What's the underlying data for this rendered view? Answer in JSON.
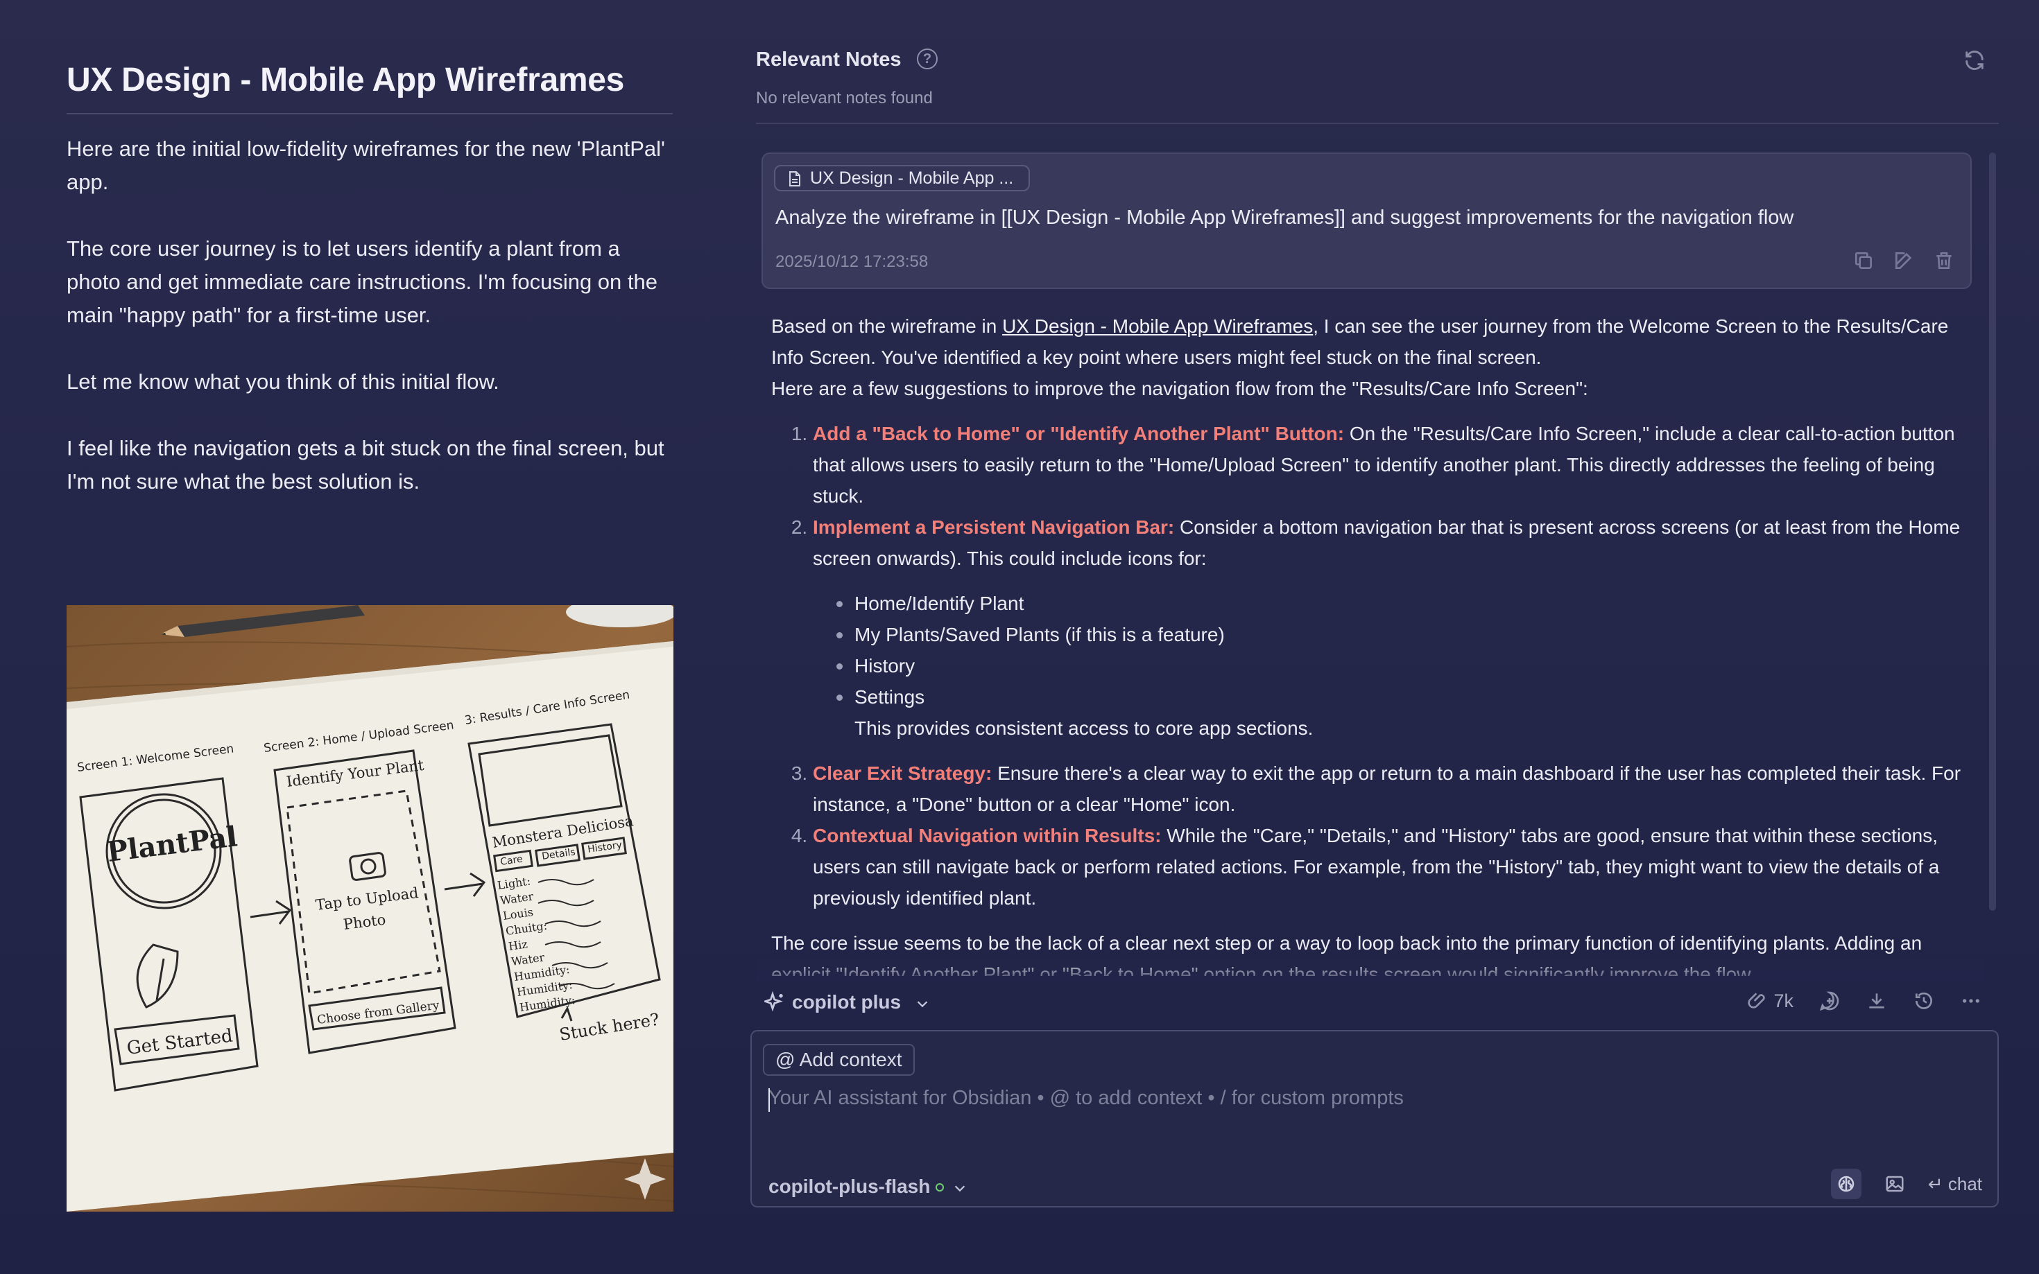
{
  "note": {
    "title": "UX Design - Mobile App Wireframes",
    "paragraphs": [
      "Here are the initial low-fidelity wireframes for the new 'PlantPal' app.",
      "The core user journey is to let users identify a plant from a photo and get immediate care instructions. I'm focusing on the main \"happy path\" for a first-time user.",
      "Let me know what you think of this initial flow.",
      "I feel like the navigation gets a bit stuck on the final screen, but I'm not sure what the best solution is."
    ],
    "image": {
      "screen1_label": "Screen 1: Welcome Screen",
      "screen2_label": "Screen 2: Home / Upload Screen",
      "screen3_label": "3: Results / Care Info Screen",
      "logo": "PlantPal",
      "get_started": "Get Started",
      "identify": "Identify Your Plant",
      "tap_upload_1": "Tap to Upload",
      "tap_upload_2": "Photo",
      "gallery": "Choose from Gallery",
      "plant_name": "Monstera Deliciosa",
      "tabs": [
        "Care",
        "Details",
        "History"
      ],
      "care_rows": [
        "Light:",
        "Water",
        "Louis",
        "Chuitg:",
        "Hiz",
        "Water",
        "Humidity:",
        "Humidity:",
        "Humidity:"
      ],
      "stuck": "Stuck here?"
    }
  },
  "relevant": {
    "title": "Relevant Notes",
    "empty": "No relevant notes found"
  },
  "user_message": {
    "context_chip": "UX Design - Mobile App ...",
    "text": "Analyze the wireframe in [[UX Design - Mobile App Wireframes]] and suggest improvements for the navigation flow",
    "timestamp": "2025/10/12 17:23:58"
  },
  "reply": {
    "intro_before_link": "Based on the wireframe in ",
    "intro_link": "UX Design - Mobile App Wireframes",
    "intro_after_link": ", I can see the user journey from the Welcome Screen to the Results/Care Info Screen. You've identified a key point where users might feel stuck on the final screen.",
    "intro_line2": "Here are a few suggestions to improve the navigation flow from the \"Results/Care Info Screen\":",
    "items": [
      {
        "title": "Add a \"Back to Home\" or \"Identify Another Plant\" Button:",
        "body": " On the \"Results/Care Info Screen,\" include a clear call-to-action button that allows users to easily return to the \"Home/Upload Screen\" to identify another plant. This directly addresses the feeling of being stuck."
      },
      {
        "title": "Implement a Persistent Navigation Bar:",
        "body": " Consider a bottom navigation bar that is present across screens (or at least from the Home screen onwards). This could include icons for:"
      },
      {
        "title": "Clear Exit Strategy:",
        "body": " Ensure there's a clear way to exit the app or return to a main dashboard if the user has completed their task. For instance, a \"Done\" button or a clear \"Home\" icon."
      },
      {
        "title": "Contextual Navigation within Results:",
        "body": " While the \"Care,\" \"Details,\" and \"History\" tabs are good, ensure that within these sections, users can still navigate back or perform related actions. For example, from the \"History\" tab, they might want to view the details of a previously identified plant."
      }
    ],
    "nav_icons": [
      "Home/Identify Plant",
      "My Plants/Saved Plants (if this is a feature)",
      "History",
      "Settings"
    ],
    "nav_note": "This provides consistent access to core app sections.",
    "conclusion": "The core issue seems to be the lack of a clear next step or a way to loop back into the primary function of identifying plants. Adding an explicit \"Identify Another Plant\" or \"Back to Home\" option on the results screen would significantly improve the flow."
  },
  "toolbar": {
    "mode": "copilot plus",
    "tokens": "7k"
  },
  "input": {
    "add_context": "@ Add context",
    "placeholder": "Your AI assistant for Obsidian • @ to add context • / for custom prompts",
    "model": "copilot-plus-flash",
    "send_label": "↵ chat"
  },
  "colors": {
    "background": "#25274b",
    "highlight": "#f37f79",
    "model_status": "#6fd06f"
  }
}
